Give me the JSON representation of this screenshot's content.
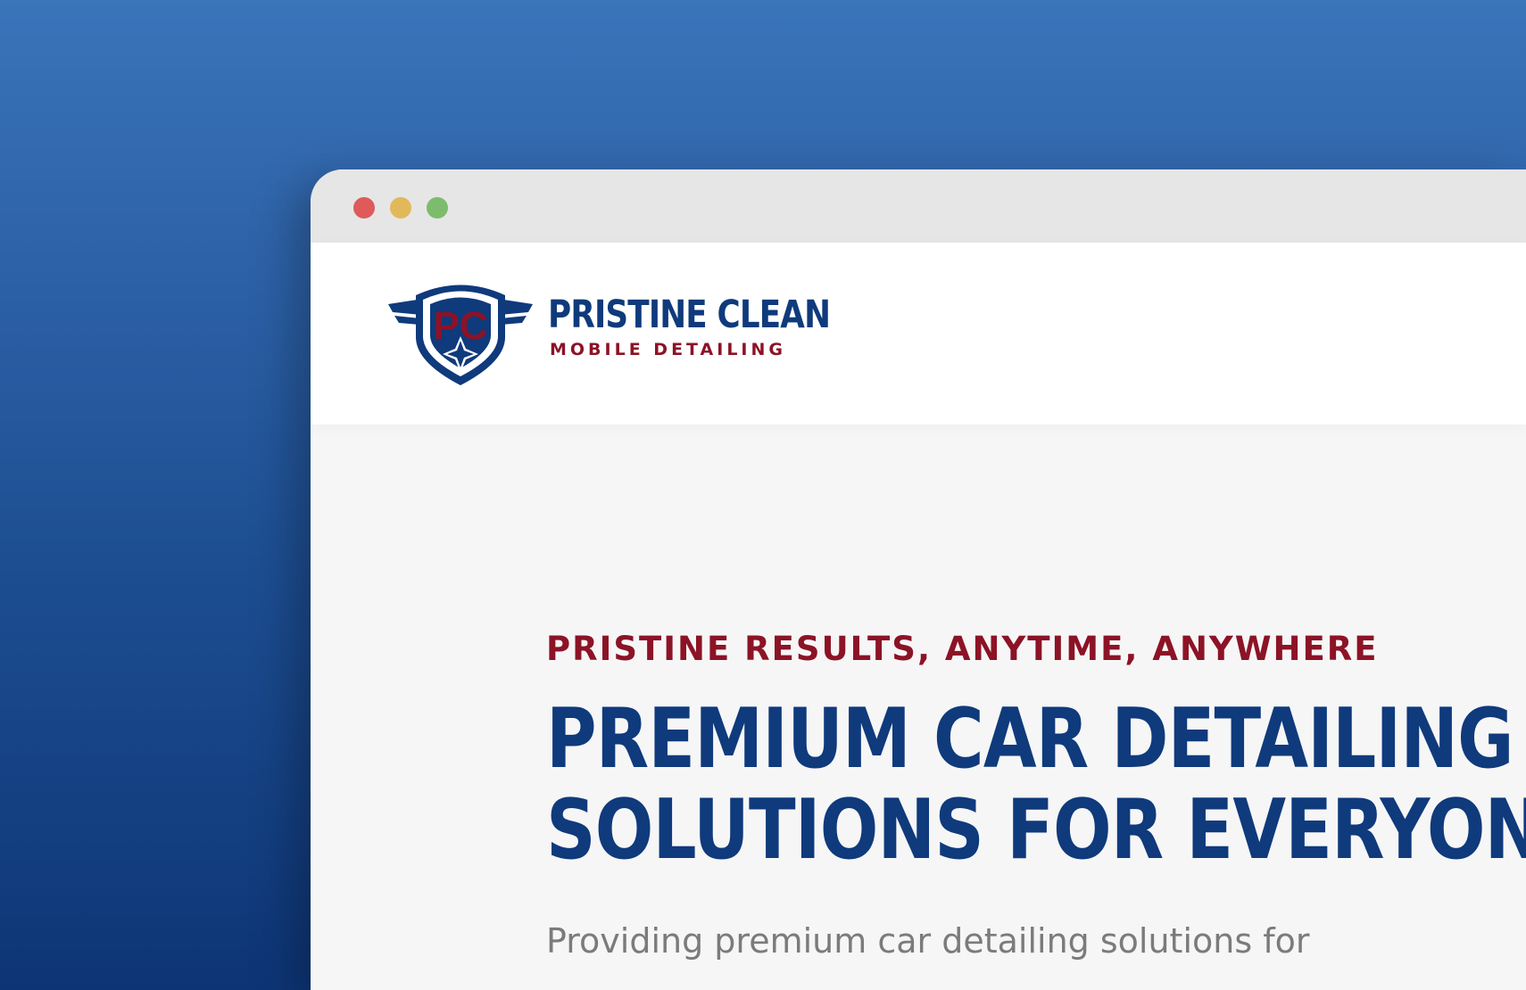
{
  "colors": {
    "background_top": "#3a74b9",
    "background_bottom": "#0d3576",
    "brand_blue": "#0f3a7c",
    "brand_red": "#8c1326",
    "body_text": "#7b7b7b"
  },
  "browser": {
    "controls": [
      "close",
      "minimize",
      "zoom"
    ]
  },
  "header": {
    "logo_initials": "PC",
    "brand_name": "PRISTINE CLEAN",
    "brand_tagline": "MOBILE DETAILING"
  },
  "hero": {
    "eyebrow": "PRISTINE RESULTS, ANYTIME, ANYWHERE",
    "headline_line_1": "PREMIUM CAR DETAILING",
    "headline_line_2": "SOLUTIONS FOR EVERYONE",
    "subtext": "Providing premium car detailing solutions for"
  }
}
